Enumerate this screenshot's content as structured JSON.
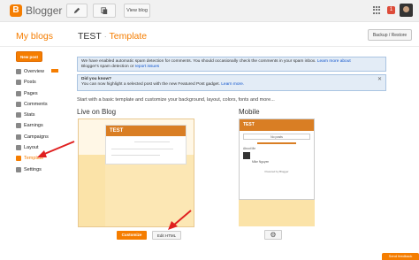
{
  "app": {
    "logo_letter": "B",
    "name": "Blogger"
  },
  "topbar": {
    "view_blog_label": "View blog",
    "notification_count": "1",
    "icons": [
      "pencil-icon",
      "copy-icon",
      "apps-icon",
      "avatar"
    ]
  },
  "header": {
    "my_blogs": "My blogs",
    "blog_name": "TEST",
    "separator": "·",
    "section": "Template",
    "backup_label": "Backup / Restore"
  },
  "sidebar": {
    "new_post_label": "New post",
    "items": [
      {
        "label": "Overview",
        "icon": "overview-icon"
      },
      {
        "label": "Posts",
        "icon": "posts-icon"
      },
      {
        "label": "Pages",
        "icon": "pages-icon"
      },
      {
        "label": "Comments",
        "icon": "comments-icon"
      },
      {
        "label": "Stats",
        "icon": "stats-icon"
      },
      {
        "label": "Earnings",
        "icon": "earnings-icon"
      },
      {
        "label": "Campaigns",
        "icon": "campaigns-icon"
      },
      {
        "label": "Layout",
        "icon": "layout-icon"
      },
      {
        "label": "Template",
        "icon": "template-icon",
        "active": true
      },
      {
        "label": "Settings",
        "icon": "settings-icon"
      }
    ]
  },
  "notices": {
    "spam_text": "We have enabled automatic spam detection for comments. You should occasionally check the comments in your spam inbox.",
    "spam_link1": "Learn more about",
    "spam_text2": "Blogger's spam detection",
    "spam_text3": "or",
    "spam_link2": "report issues",
    "did_you_know_title": "Did you know?",
    "did_you_know_text": "You can now highlight a selected post with the new Featured Post gadget.",
    "did_you_know_link": "Learn more."
  },
  "main": {
    "intro": "Start with a basic template and customize your background, layout, colors, fonts and more...",
    "live_title": "Live on Blog",
    "mobile_title": "Mobile",
    "preview_blog_title": "TEST",
    "mobile_search_label": "No posts",
    "mobile_about_label": "About Me",
    "mobile_profile_name": "Mike Nguyen",
    "mobile_powered": "Powered by Blogger",
    "customize_label": "Customize",
    "edit_html_label": "Edit HTML",
    "gear_icon": "gear-icon"
  },
  "footer": {
    "feedback_label": "Send feedback"
  },
  "colors": {
    "accent": "#f57d00",
    "notice_bg": "#e3ecf6",
    "preview_bg": "#fce7b4",
    "arrow": "#e02020"
  }
}
